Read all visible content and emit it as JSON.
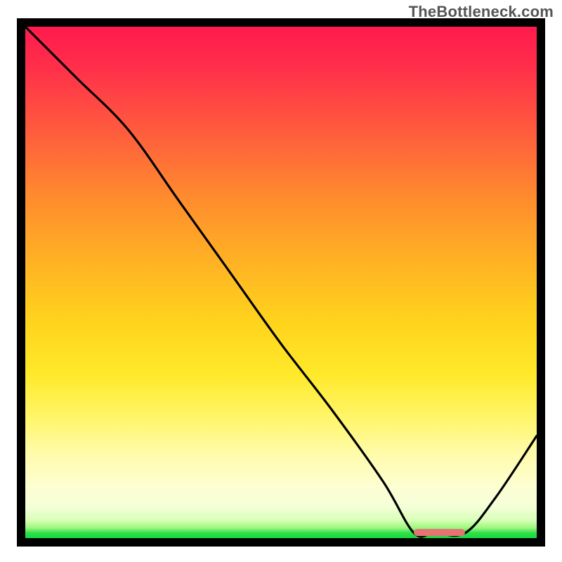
{
  "watermark": "TheBottleneck.com",
  "chart_data": {
    "type": "line",
    "title": "",
    "xlabel": "",
    "ylabel": "",
    "x_range": [
      0,
      1
    ],
    "y_range": [
      0,
      1
    ],
    "note": "Axes are unlabeled; x and y are normalized 0–1. y ≈ bottleneck magnitude (high = red, low/optimal = green). The optimal region (y≈0) lies around x≈0.76–0.86 and is marked with a pink bar.",
    "series": [
      {
        "name": "bottleneck-curve",
        "x": [
          0.0,
          0.1,
          0.2,
          0.3,
          0.4,
          0.5,
          0.6,
          0.7,
          0.76,
          0.8,
          0.86,
          0.92,
          1.0
        ],
        "y": [
          1.0,
          0.9,
          0.8,
          0.66,
          0.52,
          0.38,
          0.25,
          0.11,
          0.01,
          0.01,
          0.01,
          0.08,
          0.2
        ]
      }
    ],
    "optimal_marker": {
      "x_start": 0.76,
      "x_end": 0.86,
      "y": 0.01
    },
    "gradient_stops": [
      {
        "pos": 0.0,
        "color": "#ff1a4d"
      },
      {
        "pos": 0.33,
        "color": "#ff8a2e"
      },
      {
        "pos": 0.68,
        "color": "#ffe92a"
      },
      {
        "pos": 0.94,
        "color": "#f4ffd8"
      },
      {
        "pos": 1.0,
        "color": "#16d93f"
      }
    ]
  }
}
